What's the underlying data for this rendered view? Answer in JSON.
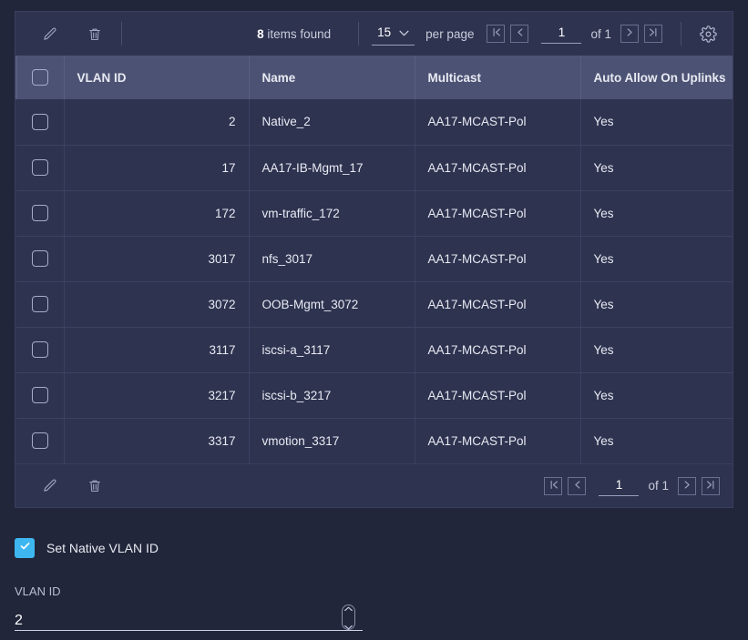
{
  "toolbar_top": {
    "edit_icon": "pencil-icon",
    "delete_icon": "trash-icon",
    "items_found_count": "8",
    "items_found_text": " items found",
    "per_page_value": "15",
    "per_page_label": "per page",
    "page_value": "1",
    "of_label": "of 1",
    "settings_icon": "gear-icon",
    "first_page_icon": "first-page-icon",
    "prev_page_icon": "prev-page-icon",
    "next_page_icon": "next-page-icon",
    "last_page_icon": "last-page-icon"
  },
  "table": {
    "columns": [
      "VLAN ID",
      "Name",
      "Multicast",
      "Auto Allow On Uplinks"
    ],
    "select_all_checked": false,
    "rows": [
      {
        "vlan_id": "2",
        "name": "Native_2",
        "multicast": "AA17-MCAST-Pol",
        "auto_allow": "Yes",
        "checked": false
      },
      {
        "vlan_id": "17",
        "name": "AA17-IB-Mgmt_17",
        "multicast": "AA17-MCAST-Pol",
        "auto_allow": "Yes",
        "checked": false
      },
      {
        "vlan_id": "172",
        "name": "vm-traffic_172",
        "multicast": "AA17-MCAST-Pol",
        "auto_allow": "Yes",
        "checked": false
      },
      {
        "vlan_id": "3017",
        "name": "nfs_3017",
        "multicast": "AA17-MCAST-Pol",
        "auto_allow": "Yes",
        "checked": false
      },
      {
        "vlan_id": "3072",
        "name": "OOB-Mgmt_3072",
        "multicast": "AA17-MCAST-Pol",
        "auto_allow": "Yes",
        "checked": false
      },
      {
        "vlan_id": "3117",
        "name": "iscsi-a_3117",
        "multicast": "AA17-MCAST-Pol",
        "auto_allow": "Yes",
        "checked": false
      },
      {
        "vlan_id": "3217",
        "name": "iscsi-b_3217",
        "multicast": "AA17-MCAST-Pol",
        "auto_allow": "Yes",
        "checked": false
      },
      {
        "vlan_id": "3317",
        "name": "vmotion_3317",
        "multicast": "AA17-MCAST-Pol",
        "auto_allow": "Yes",
        "checked": false
      }
    ]
  },
  "toolbar_bottom": {
    "edit_icon": "pencil-icon",
    "delete_icon": "trash-icon",
    "page_value": "1",
    "of_label": "of 1"
  },
  "form": {
    "native_vlan_checkbox_label": "Set Native VLAN ID",
    "native_vlan_checked": true,
    "vlan_id_label": "VLAN ID",
    "vlan_id_value": "2"
  },
  "colors": {
    "page_background": "#22263a",
    "card_background": "#2e3350",
    "header_row": "#4c5273",
    "accent": "#3eb7f0",
    "text_primary": "#e8eaf2",
    "text_muted": "#b8bdd2",
    "border": "#3d4262"
  }
}
